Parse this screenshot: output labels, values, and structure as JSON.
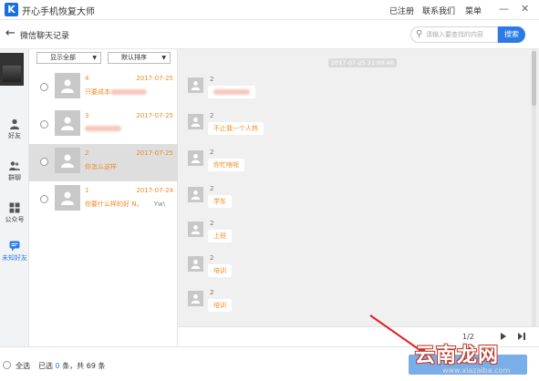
{
  "app": {
    "title": "开心手机恢复大师",
    "logo_letter": "K",
    "links": {
      "register": "已注册",
      "contact": "联系我们",
      "menu": "菜单"
    },
    "window_buttons": {
      "minimize": "—",
      "close": "✕"
    }
  },
  "header": {
    "title": "微信聊天记录",
    "search_placeholder": "请输入要查找的内容",
    "search_button": "搜索"
  },
  "nav": {
    "items": [
      {
        "label": "好友"
      },
      {
        "label": "群聊"
      },
      {
        "label": "公众号"
      },
      {
        "label": "未知好友"
      }
    ]
  },
  "filters": {
    "show_all": "显示全部",
    "sort": "默认排序"
  },
  "conversations": [
    {
      "num": "4",
      "date": "2017-07-25",
      "preview": "只要成本",
      "selected": false
    },
    {
      "num": "3",
      "date": "2017-07-25",
      "preview": "",
      "selected": false
    },
    {
      "num": "2",
      "date": "2017-07-25",
      "preview": "你怎么这样",
      "selected": true
    },
    {
      "num": "1",
      "date": "2017-07-24",
      "preview": "你要什么样的好 N。",
      "preview_tail": "Yw\\",
      "selected": false
    }
  ],
  "chat": {
    "timestamp": "2017-07-25 21:00:46",
    "messages": [
      {
        "sender": "2",
        "text": ""
      },
      {
        "sender": "2",
        "text": "不止我一个人热"
      },
      {
        "sender": "2",
        "text": "你忙啥呢"
      },
      {
        "sender": "2",
        "text": "学车"
      },
      {
        "sender": "2",
        "text": "上班"
      },
      {
        "sender": "2",
        "text": "培训"
      },
      {
        "sender": "2",
        "text": "培训"
      }
    ],
    "pager": "1/2"
  },
  "footer": {
    "select_all": "全选",
    "selected_prefix": "已选",
    "selected_count": "0",
    "selected_mid": "条，共",
    "total_count": "69",
    "selected_suffix": "条"
  },
  "watermark": {
    "brand": "云南龙网",
    "site": "www.xiazaiba.com"
  },
  "colors": {
    "accent": "#2c7be5",
    "orange": "#f08a24",
    "selected_row": "#dedede"
  }
}
